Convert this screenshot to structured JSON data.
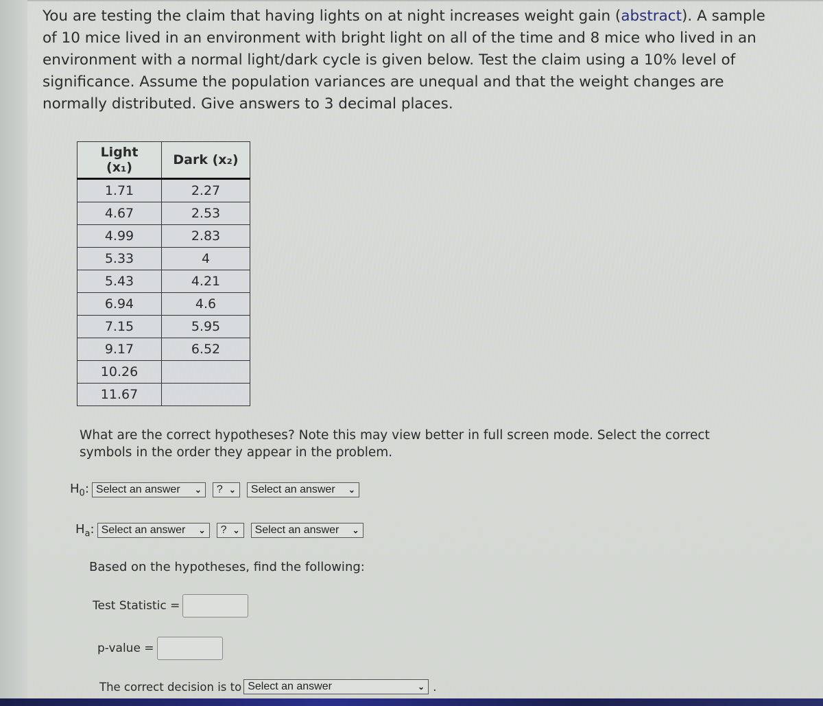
{
  "intro": {
    "text_before_link": "You are testing the claim that having lights on at night increases weight gain (",
    "link_text": "abstract",
    "text_after_link": "). A sample of 10 mice lived in an environment with bright light on all of the time and 8 mice who lived in an environment with a normal light/dark cycle is given below. Test the claim using a 10% level of significance. Assume the population variances are unequal and that the weight changes are normally distributed. Give answers to 3 decimal places."
  },
  "table": {
    "headers": [
      "Light (x₁)",
      "Dark (x₂)"
    ],
    "light": [
      "1.71",
      "4.67",
      "4.99",
      "5.33",
      "5.43",
      "6.94",
      "7.15",
      "9.17",
      "10.26",
      "11.67"
    ],
    "dark": [
      "2.27",
      "2.53",
      "2.83",
      "4",
      "4.21",
      "4.6",
      "5.95",
      "6.52",
      "",
      ""
    ]
  },
  "question": "What are the correct hypotheses? Note this may view better in full screen mode. Select the correct symbols in the order they appear in the problem.",
  "h0": {
    "label": "H",
    "sub": "0",
    "colon": ":",
    "select1": "Select an answer",
    "operator": "?",
    "select2": "Select an answer"
  },
  "ha": {
    "label": "H",
    "sub": "a",
    "colon": ":",
    "select1": "Select an answer",
    "operator": "?",
    "select2": "Select an answer"
  },
  "based_text": "Based on the hypotheses, find the following:",
  "test_statistic": {
    "label": "Test Statistic =",
    "value": ""
  },
  "p_value": {
    "label": "p-value =",
    "value": ""
  },
  "decision": {
    "label": "The correct decision is to",
    "select": "Select an answer",
    "end": "."
  },
  "icons": {
    "chevron": "⌵"
  }
}
